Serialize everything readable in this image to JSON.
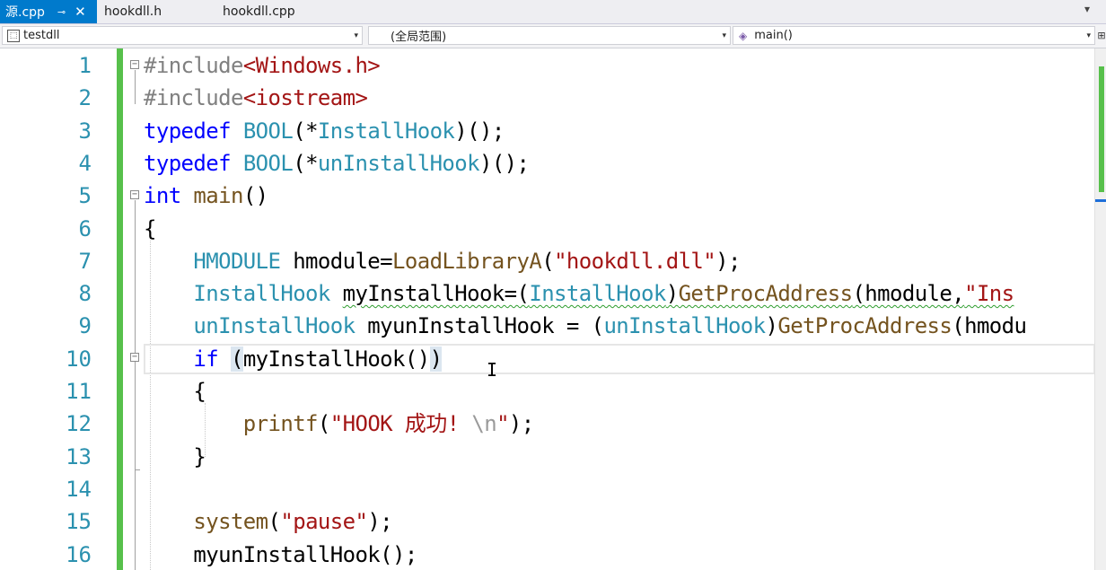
{
  "tabs": [
    {
      "label": "源.cpp",
      "active": true,
      "pin": "⊸",
      "close": "✕"
    },
    {
      "label": "hookdll.h",
      "active": false
    },
    {
      "label": "hookdll.cpp",
      "active": false
    }
  ],
  "tab_menu_glyph": "▾",
  "nav": {
    "project": "testdll",
    "scope": "(全局范围)",
    "member": "main()",
    "arrow": "▾"
  },
  "editor": {
    "line_numbers": [
      "1",
      "2",
      "3",
      "4",
      "5",
      "6",
      "7",
      "8",
      "9",
      "10",
      "11",
      "12",
      "13",
      "14",
      "15",
      "16"
    ],
    "lines": [
      [
        {
          "t": "#include",
          "c": "pp"
        },
        {
          "t": "<Windows.h>",
          "c": "inc"
        }
      ],
      [
        {
          "t": "#include",
          "c": "pp"
        },
        {
          "t": "<iostream>",
          "c": "inc"
        }
      ],
      [
        {
          "t": "typedef",
          "c": "kw"
        },
        {
          "t": " "
        },
        {
          "t": "BOOL",
          "c": "ty"
        },
        {
          "t": "(*"
        },
        {
          "t": "InstallHook",
          "c": "ty"
        },
        {
          "t": ")();"
        }
      ],
      [
        {
          "t": "typedef",
          "c": "kw"
        },
        {
          "t": " "
        },
        {
          "t": "BOOL",
          "c": "ty"
        },
        {
          "t": "(*"
        },
        {
          "t": "unInstallHook",
          "c": "ty"
        },
        {
          "t": ")();"
        }
      ],
      [
        {
          "t": "int",
          "c": "kw"
        },
        {
          "t": " "
        },
        {
          "t": "main",
          "c": "fn"
        },
        {
          "t": "()"
        }
      ],
      [
        {
          "t": "{"
        }
      ],
      [
        {
          "t": "    "
        },
        {
          "t": "HMODULE",
          "c": "ty"
        },
        {
          "t": " hmodule="
        },
        {
          "t": "LoadLibraryA",
          "c": "fn"
        },
        {
          "t": "("
        },
        {
          "t": "\"hookdll.dll\"",
          "c": "str"
        },
        {
          "t": ");"
        }
      ],
      [
        {
          "t": "    "
        },
        {
          "t": "InstallHook",
          "c": "ty"
        },
        {
          "t": " "
        },
        {
          "t": "myInstallHook=(",
          "c": "squig"
        },
        {
          "t": "InstallHook",
          "c": "ty squig"
        },
        {
          "t": ")",
          "c": "squig"
        },
        {
          "t": "GetProcAddress",
          "c": "fn squig"
        },
        {
          "t": "(hmodule,",
          "c": "squig"
        },
        {
          "t": "\"Ins",
          "c": "str squig"
        }
      ],
      [
        {
          "t": "    "
        },
        {
          "t": "unInstallHook",
          "c": "ty"
        },
        {
          "t": " myunInstallHook = ("
        },
        {
          "t": "unInstallHook",
          "c": "ty"
        },
        {
          "t": ")"
        },
        {
          "t": "GetProcAddress",
          "c": "fn"
        },
        {
          "t": "(hmodu"
        }
      ],
      [
        {
          "t": "    "
        },
        {
          "t": "if",
          "c": "kw"
        },
        {
          "t": " "
        },
        {
          "t": "(",
          "c": "brace-hl"
        },
        {
          "t": "myInstallHook()"
        },
        {
          "t": ")",
          "c": "brace-hl"
        }
      ],
      [
        {
          "t": "    {"
        }
      ],
      [
        {
          "t": "        "
        },
        {
          "t": "printf",
          "c": "fn"
        },
        {
          "t": "("
        },
        {
          "t": "\"HOOK 成功! ",
          "c": "str"
        },
        {
          "t": "\\n",
          "c": "esc"
        },
        {
          "t": "\"",
          "c": "str"
        },
        {
          "t": ");"
        }
      ],
      [
        {
          "t": "    }"
        }
      ],
      [],
      [
        {
          "t": "    "
        },
        {
          "t": "system",
          "c": "fn"
        },
        {
          "t": "("
        },
        {
          "t": "\"pause\"",
          "c": "str"
        },
        {
          "t": ");"
        }
      ],
      [
        {
          "t": "    "
        },
        {
          "t": "myunInstallHook();"
        }
      ]
    ]
  },
  "colors": {
    "tab_active": "#007acc",
    "line_number": "#2b91af",
    "keyword": "#0000ff",
    "type": "#2b91af",
    "function": "#74531f",
    "string": "#a31515",
    "change_bar": "#57c04b"
  }
}
